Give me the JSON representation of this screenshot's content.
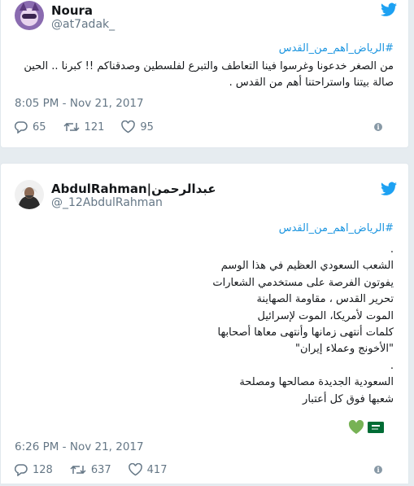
{
  "colors": {
    "accent": "#1da1f2",
    "hashtag": "#1b95e0",
    "muted": "#657786",
    "text": "#14171a",
    "border": "#e1e8ed",
    "heart_emoji": "#77b255",
    "saudi_flag": "#006c35"
  },
  "tweets": [
    {
      "display_name": "Noura",
      "handle": "@at7adak_",
      "hashtag": "#الرياض_اهم_من_القدس",
      "body_lines": [
        "من الصغر خدعونا وغرسوا فينا التعاطف والتبرع لفلسطين وصدقناكم !! كبرنا .. الحين",
        "صالة بيتنا واستراحتنا أهم من القدس ."
      ],
      "timestamp": "8:05 PM - Nov 21, 2017",
      "replies": "65",
      "retweets": "121",
      "likes": "95"
    },
    {
      "display_name": "AbdulRahman|عبدالرحمن",
      "handle": "@_12AbdulRahman",
      "hashtag": "#الرياض_اهم_من_القدس",
      "body_lines": [
        ".",
        "الشعب السعودي العظيم في هذا الوسم",
        "يفوتون الفرصة على مستخدمي الشعارات",
        "تحرير القدس ، مقاومة الصهاينة",
        "الموت لأمريكا، الموت لإسرائيل",
        "كلمات أنتهى زمانها وأنتهى معاها أصحابها",
        "\"الأخونج وعملاء إيران\"",
        ".",
        "السعودية الجديدة مصالحها ومصلحة",
        "شعبها فوق كل أعتبار"
      ],
      "emojis": [
        "green-heart",
        "saudi-flag"
      ],
      "timestamp": "6:26 PM - Nov 21, 2017",
      "replies": "128",
      "retweets": "637",
      "likes": "417"
    }
  ]
}
